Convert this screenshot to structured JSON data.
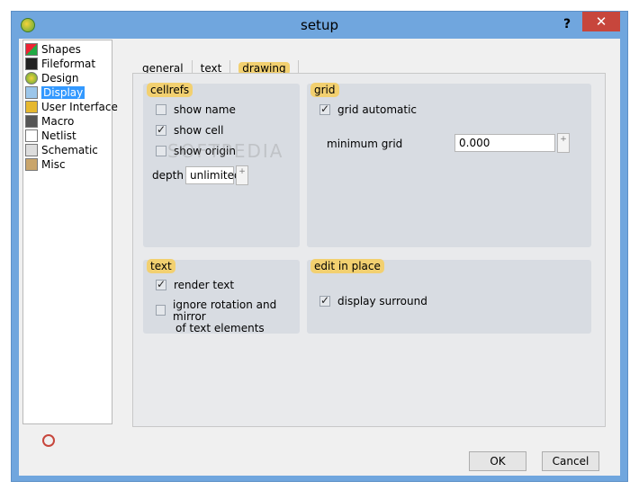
{
  "window": {
    "title": "setup",
    "help": "?",
    "close": "✕"
  },
  "sidebar": {
    "items": [
      {
        "label": "Shapes",
        "icon": "shapes-icon"
      },
      {
        "label": "Fileformat",
        "icon": "floppy-icon"
      },
      {
        "label": "Design",
        "icon": "design-icon"
      },
      {
        "label": "Display",
        "icon": "display-icon",
        "selected": true
      },
      {
        "label": "User Interface",
        "icon": "user-interface-icon"
      },
      {
        "label": "Macro",
        "icon": "macro-icon"
      },
      {
        "label": "Netlist",
        "icon": "netlist-icon"
      },
      {
        "label": "Schematic",
        "icon": "schematic-icon"
      },
      {
        "label": "Misc",
        "icon": "box-icon"
      }
    ]
  },
  "tabs": [
    {
      "label": "general"
    },
    {
      "label": "text"
    },
    {
      "label": "drawing",
      "active": true
    }
  ],
  "cellrefs": {
    "title": "cellrefs",
    "show_name": {
      "label": "show name",
      "checked": false
    },
    "show_cell": {
      "label": "show cell",
      "checked": true
    },
    "show_origin": {
      "label": "show origin",
      "checked": false
    },
    "depth_label": "depth",
    "depth_value": "unlimited"
  },
  "grid": {
    "title": "grid",
    "automatic": {
      "label": "grid automatic",
      "checked": true
    },
    "minimum_label": "minimum grid",
    "minimum_value": "0.000"
  },
  "text": {
    "title": "text",
    "render_text": {
      "label": "render text",
      "checked": true
    },
    "ignore_rotation": {
      "label_line1": "ignore rotation and mirror",
      "label_line2": "of text elements",
      "checked": false
    }
  },
  "edit_in_place": {
    "title": "edit in place",
    "display_surround": {
      "label": "display surround",
      "checked": true
    }
  },
  "buttons": {
    "ok": "OK",
    "cancel": "Cancel"
  },
  "spin_glyph": "+",
  "watermark": "SOFTPEDIA"
}
